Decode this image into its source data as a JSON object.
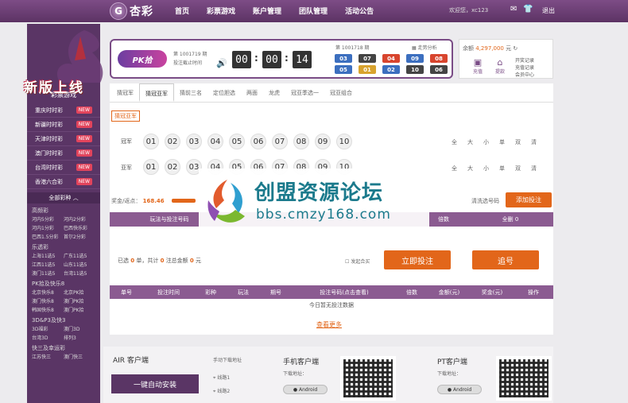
{
  "topbar": {
    "logo_icon": "G",
    "logo_text": "杏彩",
    "nav": [
      "首页",
      "彩票游戏",
      "账户管理",
      "团队管理",
      "活动公告"
    ],
    "welcome": "欢迎您，xc123",
    "logout": "退出"
  },
  "sidebar": {
    "banner_title": "新版上线",
    "header": "彩票游戏",
    "items": [
      {
        "label": "重庆时时彩",
        "badge": "NEW"
      },
      {
        "label": "新疆时时彩",
        "badge": "NEW"
      },
      {
        "label": "天津时时彩",
        "badge": "NEW"
      },
      {
        "label": "澳门时时彩",
        "badge": "NEW"
      },
      {
        "label": "台湾时时彩",
        "badge": "NEW"
      },
      {
        "label": "香港六合彩",
        "badge": "NEW"
      }
    ],
    "expand_label": "全部彩种 ︿",
    "groups": [
      {
        "title": "高频彩",
        "items": [
          "河内5分彩",
          "河内2分彩",
          "河内1分彩",
          "巴西快乐彩",
          "巴西1.5分彩",
          "首尔2分彩"
        ]
      },
      {
        "title": "乐透彩",
        "items": [
          "上海11选5",
          "广东11选5",
          "江西11选5",
          "山东11选5",
          "澳门11选5",
          "台湾11选5"
        ]
      },
      {
        "title": "PK拾及快乐8",
        "items": [
          "北京快乐8",
          "北京PK拾",
          "澳门快乐8",
          "澳门PK拾",
          "韩国快乐8",
          "澳门PK拾"
        ]
      },
      {
        "title": "3D&P3及快3",
        "items": [
          "3D福彩",
          "澳门3D",
          "台湾3D",
          "排列3"
        ]
      },
      {
        "title": "快三及幸运彩",
        "items": [
          "江苏快三",
          "澳门快三"
        ]
      }
    ]
  },
  "game": {
    "logo": "PK拾",
    "issue_label": "第 1001719 期",
    "deadline_label": "投注截止时间",
    "time": [
      "00",
      "00",
      "14"
    ],
    "last_issue": "第 1001718 期",
    "trend": "走势分析",
    "results": [
      "03",
      "07",
      "04",
      "09",
      "08",
      "05",
      "01",
      "02",
      "10",
      "06"
    ],
    "result_colors": [
      "#3c6fbf",
      "#444444",
      "#d8452e",
      "#3c6fbf",
      "#d8452e",
      "#3c6fbf",
      "#d8a32e",
      "#3c6fbf",
      "#444444",
      "#444444"
    ]
  },
  "balance": {
    "label": "余额",
    "amount": "4,297,000",
    "unit": "元",
    "recharge": "充值",
    "withdraw": "提款",
    "links": [
      "开奖记录",
      "充值记录",
      "会员中心"
    ]
  },
  "panel": {
    "tabs": [
      "猜冠军",
      "猜冠亚军",
      "猜前三名",
      "定位胆选",
      "两面",
      "龙虎",
      "冠亚季选一",
      "冠亚组合"
    ],
    "active_tab": "猜冠亚军",
    "sub_tab": "猜冠亚军",
    "rows": [
      {
        "label": "冠军",
        "numbers": [
          "01",
          "02",
          "03",
          "04",
          "05",
          "06",
          "07",
          "08",
          "09",
          "10"
        ]
      },
      {
        "label": "亚军",
        "numbers": [
          "01",
          "02",
          "03",
          "04",
          "05",
          "06",
          "07",
          "08",
          "09",
          "10"
        ]
      }
    ],
    "quick": [
      "全",
      "大",
      "小",
      "单",
      "双",
      "清"
    ],
    "amount_label": "奖金/返点：",
    "amount_value": "168.46",
    "clear_label": "清洗选号码",
    "add_button": "添加投注",
    "table_headers": [
      "玩法与投注号码",
      "",
      "",
      "",
      "",
      "倍数",
      "全删 0"
    ],
    "summary_prefix": "已选",
    "summary_count": "0",
    "summary_unit": "单，共计",
    "summary_notes": "0",
    "summary_amount_label": "注总金额",
    "summary_amount": "0",
    "summary_currency": "元",
    "chase_check": "发起合买",
    "bet_button": "立即投注",
    "chase_button": "追号",
    "record_headers": [
      "单号",
      "投注时间",
      "彩种",
      "玩法",
      "期号",
      "投注号码(点击查看)",
      "倍数",
      "金额(元)",
      "奖金(元)",
      "操作"
    ],
    "empty_text": "今日暂无投注数据",
    "more_text": "查看更多"
  },
  "download": {
    "air_title": "AIR 客户端",
    "auto_install": "一键自动安装",
    "manual_label": "手动下载地址",
    "line1": "线路1",
    "line2": "线路2",
    "mobile_title": "手机客户端",
    "mobile_sub": "下载地址：",
    "pt_title": "PT客户端",
    "pt_sub": "下载地址：",
    "android": "Android"
  },
  "watermark": {
    "text1": "创盟资源论坛",
    "text2": "bbs.cmzy168.com"
  }
}
